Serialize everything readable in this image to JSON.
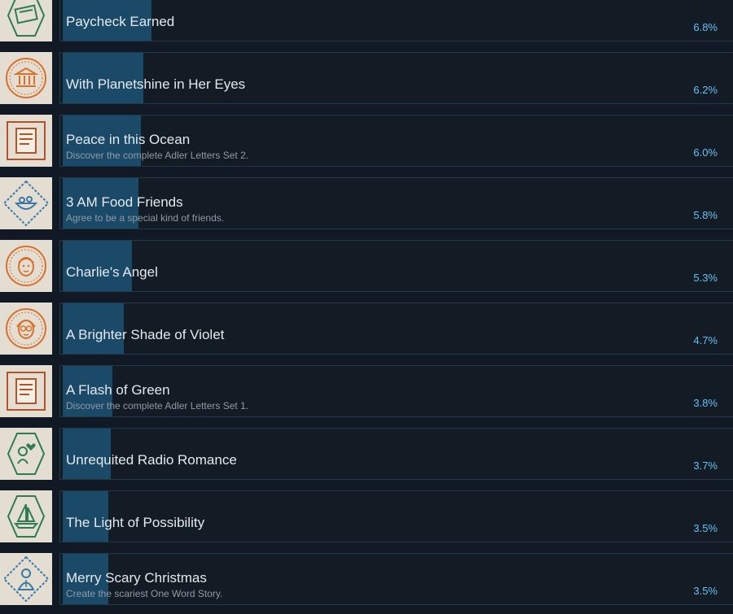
{
  "colors": {
    "background": "#111a24",
    "panel": "#131b25",
    "panel_border": "#23384b",
    "progress_fill": "#1b4a68",
    "title_text": "#e4e9ee",
    "desc_text": "#8f9aa6",
    "percent_text": "#66c0f4"
  },
  "achievements": [
    {
      "title": "Paycheck Earned",
      "desc": "",
      "percent": "6.8%",
      "fill_percent": 6.8,
      "icon": "paycheck-envelope-icon",
      "icon_color": "#2e7d52"
    },
    {
      "title": "With Planetshine in Her Eyes",
      "desc": "",
      "percent": "6.2%",
      "fill_percent": 6.2,
      "icon": "building-columns-icon",
      "icon_color": "#d9712b"
    },
    {
      "title": "Peace in this Ocean",
      "desc": "Discover the complete Adler Letters Set 2.",
      "percent": "6.0%",
      "fill_percent": 6.0,
      "icon": "letter-document-icon",
      "icon_color": "#b2532a"
    },
    {
      "title": "3 AM Food Friends",
      "desc": "Agree to be a special kind of friends.",
      "percent": "5.8%",
      "fill_percent": 5.8,
      "icon": "food-bowl-icon",
      "icon_color": "#3a78a8"
    },
    {
      "title": "Charlie's Angel",
      "desc": "",
      "percent": "5.3%",
      "fill_percent": 5.3,
      "icon": "face-portrait-icon",
      "icon_color": "#d9712b"
    },
    {
      "title": "A Brighter Shade of Violet",
      "desc": "",
      "percent": "4.7%",
      "fill_percent": 4.7,
      "icon": "face-glasses-icon",
      "icon_color": "#d9712b"
    },
    {
      "title": "A Flash of Green",
      "desc": "Discover the complete Adler Letters Set 1.",
      "percent": "3.8%",
      "fill_percent": 3.8,
      "icon": "letter-document-icon",
      "icon_color": "#b2532a"
    },
    {
      "title": "Unrequited Radio Romance",
      "desc": "",
      "percent": "3.7%",
      "fill_percent": 3.7,
      "icon": "radio-romance-icon",
      "icon_color": "#2e7d52"
    },
    {
      "title": "The Light of Possibility",
      "desc": "",
      "percent": "3.5%",
      "fill_percent": 3.5,
      "icon": "sailboat-icon",
      "icon_color": "#2e7d52"
    },
    {
      "title": "Merry Scary Christmas",
      "desc": "Create the scariest One Word Story.",
      "percent": "3.5%",
      "fill_percent": 3.5,
      "icon": "christmas-figure-icon",
      "icon_color": "#3a78a8"
    }
  ]
}
